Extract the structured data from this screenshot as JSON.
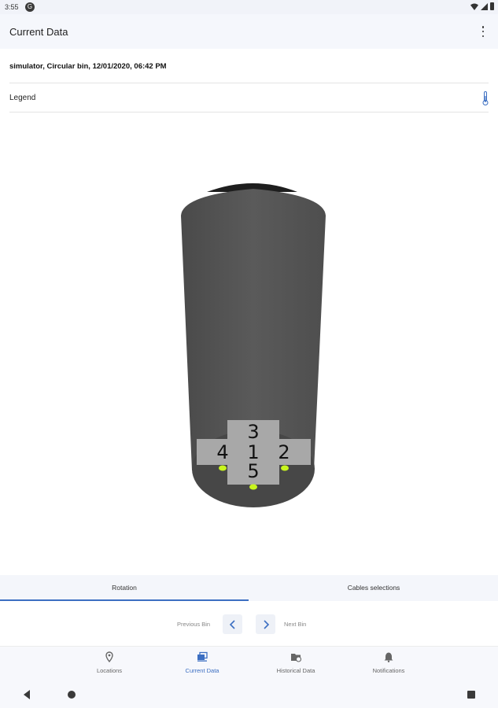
{
  "status_bar": {
    "time": "3:55",
    "app_icon": "G"
  },
  "app_bar": {
    "title": "Current Data",
    "overflow_icon": "more-vert-icon"
  },
  "bin_info": "simulator, Circular bin, 12/01/2020, 06:42 PM",
  "legend": {
    "label": "Legend",
    "icon": "thermometer-icon"
  },
  "bin_view": {
    "cable_labels": [
      "3",
      "4",
      "1",
      "2",
      "5"
    ],
    "sensor_color": "#c8f51e",
    "body_color": "#555555",
    "label_panel_color": "#aaaaaa"
  },
  "tabs": [
    {
      "label": "Rotation",
      "active": true
    },
    {
      "label": "Cables selections",
      "active": false
    }
  ],
  "bin_nav": {
    "previous_label": "Previous Bin",
    "next_label": "Next Bin"
  },
  "bottom_nav": [
    {
      "label": "Locations",
      "icon": "location-pin-icon",
      "active": false
    },
    {
      "label": "Current Data",
      "icon": "current-data-icon",
      "active": true
    },
    {
      "label": "Historical Data",
      "icon": "historical-data-icon",
      "active": false
    },
    {
      "label": "Notifications",
      "icon": "bell-icon",
      "active": false
    }
  ],
  "colors": {
    "accent": "#3c6fc2",
    "app_bar_bg": "#f5f7fc"
  }
}
